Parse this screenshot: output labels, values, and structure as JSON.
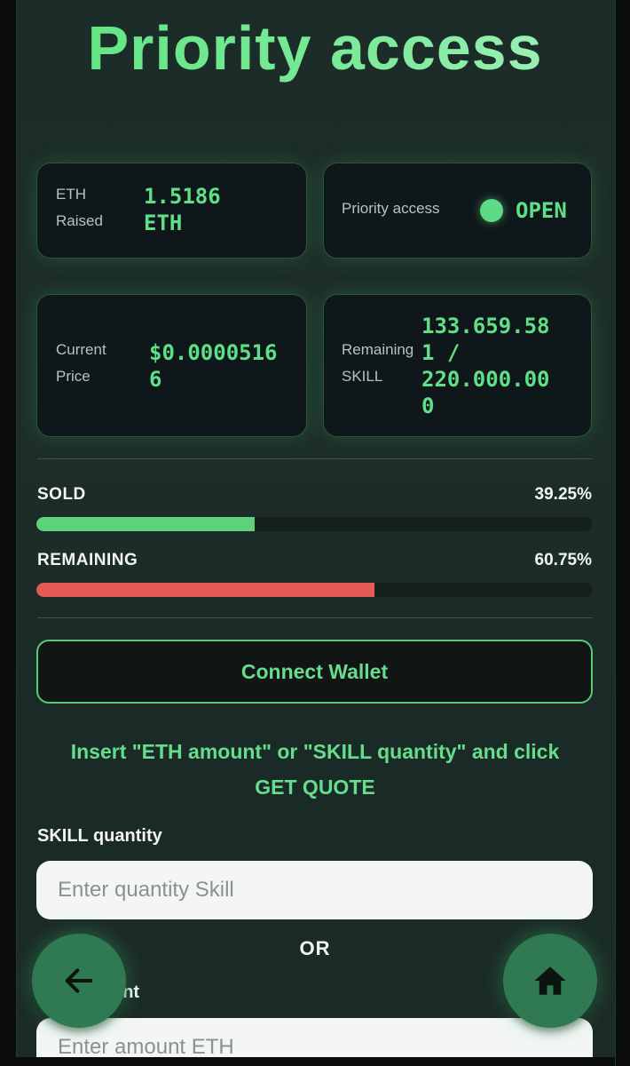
{
  "header": {
    "title": "Priority access"
  },
  "stats": {
    "eth_raised": {
      "label_line1": "ETH",
      "label_line2": "Raised",
      "value_line1": "1.5186",
      "value_line2": "ETH"
    },
    "priority_access": {
      "label": "Priority access",
      "status": "OPEN"
    },
    "current_price": {
      "label_line1": "Current",
      "label_line2": "Price",
      "value_line1": "$0.0000516",
      "value_line2": "6"
    },
    "remaining": {
      "label_line1": "Remaining",
      "label_line2": "SKILL",
      "value_lines": [
        "133.659.58",
        "1 /",
        "220.000.00",
        "0"
      ]
    }
  },
  "progress": {
    "sold": {
      "label": "SOLD",
      "percent_text": "39.25%",
      "fraction": 0.3925,
      "color": "#5ed27b"
    },
    "remaining": {
      "label": "REMAINING",
      "percent_text": "60.75%",
      "fraction": 0.6075,
      "color": "#e45a57"
    }
  },
  "wallet": {
    "connect_label": "Connect Wallet"
  },
  "instructions": {
    "line1": "Insert \"ETH amount\" or \"SKILL quantity\" and click",
    "line2": "GET QUOTE"
  },
  "form": {
    "skill_label": "SKILL quantity",
    "skill_placeholder": "Enter quantity Skill",
    "or_text": "OR",
    "eth_label_visible": "unt",
    "eth_placeholder": "Enter amount ETH"
  },
  "colors": {
    "accent": "#5ee088",
    "fab": "#2f7a52"
  },
  "icons": {
    "back": "arrow-left-icon",
    "home": "home-icon"
  }
}
